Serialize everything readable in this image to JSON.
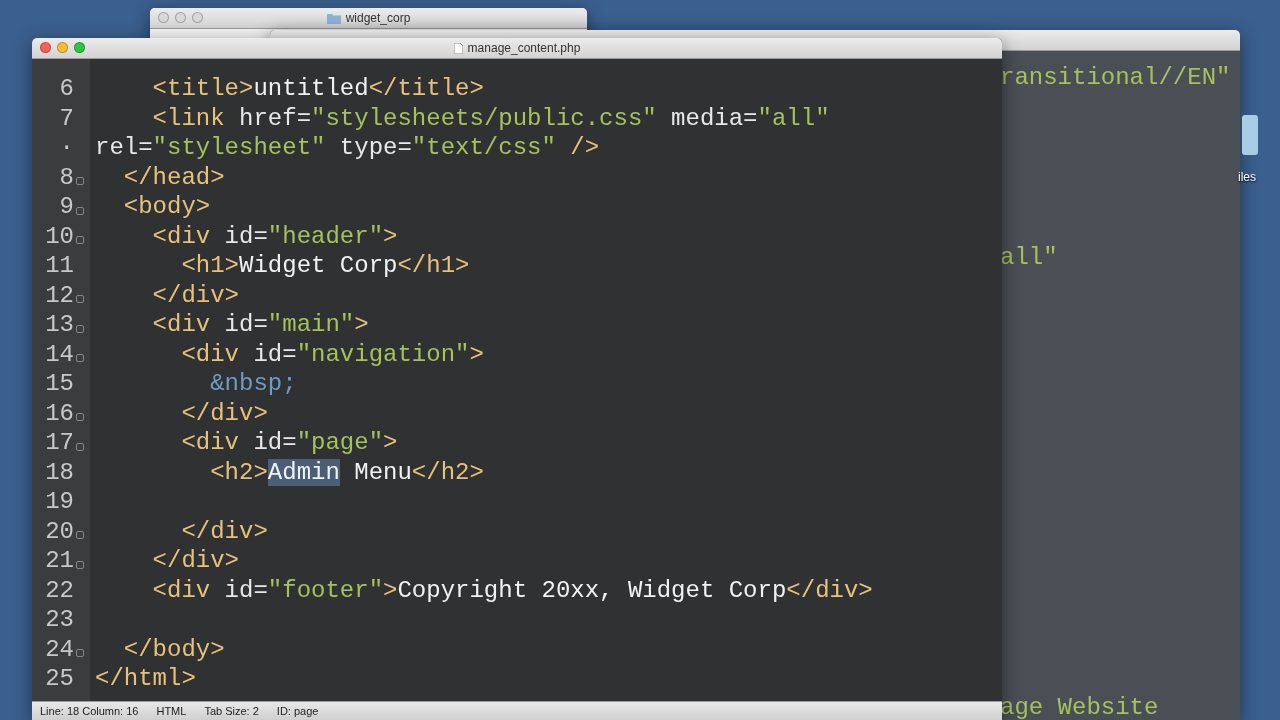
{
  "finder_window": {
    "title": "widget_corp"
  },
  "back_editor": {
    "visible_text": [
      "ransitional//EN\"",
      "all\"",
      "age Website"
    ]
  },
  "desktop_icon": {
    "label": "iles"
  },
  "editor": {
    "title": "manage_content.php",
    "lines": [
      {
        "number": "6",
        "fold": false,
        "tokens": [
          {
            "kind": "tag",
            "text": "    <title>"
          },
          {
            "kind": "text",
            "text": "untitled"
          },
          {
            "kind": "tag",
            "text": "</title>"
          }
        ]
      },
      {
        "number": "7",
        "fold": false,
        "tokens": [
          {
            "kind": "tag",
            "text": "    <link"
          },
          {
            "kind": "attr",
            "text": " href="
          },
          {
            "kind": "string",
            "text": "\"stylesheets/public.css\""
          },
          {
            "kind": "attr",
            "text": " media="
          },
          {
            "kind": "string",
            "text": "\"all\""
          }
        ]
      },
      {
        "number": "·",
        "fold": false,
        "tokens": [
          {
            "kind": "attr",
            "text": "rel="
          },
          {
            "kind": "string",
            "text": "\"stylesheet\""
          },
          {
            "kind": "attr",
            "text": " type="
          },
          {
            "kind": "string",
            "text": "\"text/css\""
          },
          {
            "kind": "tag",
            "text": " />"
          }
        ]
      },
      {
        "number": "8",
        "fold": true,
        "tokens": [
          {
            "kind": "tag",
            "text": "  </head>"
          }
        ]
      },
      {
        "number": "9",
        "fold": true,
        "tokens": [
          {
            "kind": "tag",
            "text": "  <body>"
          }
        ]
      },
      {
        "number": "10",
        "fold": true,
        "tokens": [
          {
            "kind": "tag",
            "text": "    <div"
          },
          {
            "kind": "attr",
            "text": " id="
          },
          {
            "kind": "string",
            "text": "\"header\""
          },
          {
            "kind": "tag",
            "text": ">"
          }
        ]
      },
      {
        "number": "11",
        "fold": false,
        "tokens": [
          {
            "kind": "tag",
            "text": "      <h1>"
          },
          {
            "kind": "text",
            "text": "Widget Corp"
          },
          {
            "kind": "tag",
            "text": "</h1>"
          }
        ]
      },
      {
        "number": "12",
        "fold": true,
        "tokens": [
          {
            "kind": "tag",
            "text": "    </div>"
          }
        ]
      },
      {
        "number": "13",
        "fold": true,
        "tokens": [
          {
            "kind": "tag",
            "text": "    <div"
          },
          {
            "kind": "attr",
            "text": " id="
          },
          {
            "kind": "string",
            "text": "\"main\""
          },
          {
            "kind": "tag",
            "text": ">"
          }
        ]
      },
      {
        "number": "14",
        "fold": true,
        "tokens": [
          {
            "kind": "tag",
            "text": "      <div"
          },
          {
            "kind": "attr",
            "text": " id="
          },
          {
            "kind": "string",
            "text": "\"navigation\""
          },
          {
            "kind": "tag",
            "text": ">"
          }
        ]
      },
      {
        "number": "15",
        "fold": false,
        "tokens": [
          {
            "kind": "entity",
            "text": "        &nbsp;"
          }
        ]
      },
      {
        "number": "16",
        "fold": true,
        "tokens": [
          {
            "kind": "tag",
            "text": "      </div>"
          }
        ]
      },
      {
        "number": "17",
        "fold": true,
        "tokens": [
          {
            "kind": "tag",
            "text": "      <div"
          },
          {
            "kind": "attr",
            "text": " id="
          },
          {
            "kind": "string",
            "text": "\"page\""
          },
          {
            "kind": "tag",
            "text": ">"
          }
        ]
      },
      {
        "number": "18",
        "fold": false,
        "tokens": [
          {
            "kind": "tag",
            "text": "        <h2>"
          },
          {
            "kind": "selection",
            "text": "Admin"
          },
          {
            "kind": "text",
            "text": " Menu"
          },
          {
            "kind": "tag",
            "text": "</h2>"
          }
        ]
      },
      {
        "number": "19",
        "fold": false
      },
      {
        "number": "20",
        "fold": true,
        "tokens": [
          {
            "kind": "tag",
            "text": "      </div>"
          }
        ]
      },
      {
        "number": "21",
        "fold": true,
        "tokens": [
          {
            "kind": "tag",
            "text": "    </div>"
          }
        ]
      },
      {
        "number": "22",
        "fold": false,
        "tokens": [
          {
            "kind": "tag",
            "text": "    <div"
          },
          {
            "kind": "attr",
            "text": " id="
          },
          {
            "kind": "string",
            "text": "\"footer\""
          },
          {
            "kind": "tag",
            "text": ">"
          },
          {
            "kind": "text",
            "text": "Copyright 20xx, Widget Corp"
          },
          {
            "kind": "tag",
            "text": "</div>"
          }
        ]
      },
      {
        "number": "23",
        "fold": false
      },
      {
        "number": "24",
        "fold": true,
        "tokens": [
          {
            "kind": "tag",
            "text": "  </body>"
          }
        ]
      },
      {
        "number": "25",
        "fold": false,
        "tokens": [
          {
            "kind": "tag",
            "text": "</html>"
          }
        ]
      }
    ],
    "status_bar": {
      "position": "Line: 18 Column: 16",
      "language": "HTML",
      "tab_size": "Tab Size: 2",
      "symbol": "ID: page"
    }
  }
}
